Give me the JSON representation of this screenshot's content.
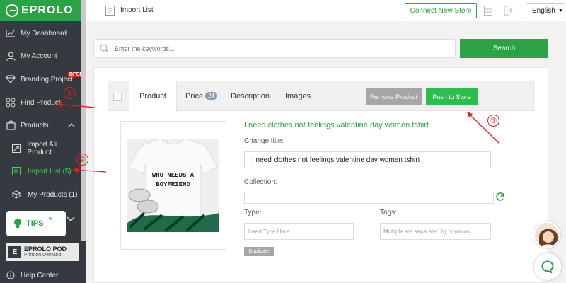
{
  "sidebar": {
    "logo": "EPROLO",
    "items": [
      {
        "label": "My Dashboard"
      },
      {
        "label": "My Account"
      },
      {
        "label": "Branding Project",
        "badge": "BFCM"
      },
      {
        "label": "Find Product"
      },
      {
        "label": "Products"
      },
      {
        "label": "Import Ali Product"
      },
      {
        "label": "Import List (5)"
      },
      {
        "label": "My Products (1)"
      }
    ],
    "tips": "TIPS",
    "pod_line1": "EPROLO POD",
    "pod_line2": "Print on Demand",
    "help": "Help Center"
  },
  "header": {
    "title": "Import List",
    "connect_label": "Connect New Store",
    "language": "English"
  },
  "search": {
    "placeholder": "Enter the keywords...",
    "button": "Search"
  },
  "product": {
    "tabs": [
      {
        "label": "Product"
      },
      {
        "label": "Price",
        "badge": "24"
      },
      {
        "label": "Description"
      },
      {
        "label": "Images"
      }
    ],
    "remove_label": "Remove Product",
    "push_label": "Push to Store",
    "title": "I need clothes not feelings valentine day women tshirt",
    "change_title_label": "Change title:",
    "change_title_value": "I need clothes not feelings  valentine day women tshirt",
    "collection_label": "Collection:",
    "type_label": "Type:",
    "type_placeholder": "Insert Type Here",
    "tags_label": "Tags:",
    "tags_placeholder": "Multiple are separated by commas",
    "duplicate_label": "Duplicate",
    "shirt_text_1": "WHO NEEDS A",
    "shirt_text_2": "BOYFRIEND"
  },
  "annotations": [
    "①",
    "②",
    "③"
  ],
  "colors": {
    "brand_green": "#2ba245",
    "sidebar_bg": "#343a40",
    "annotation_red": "#e02020"
  }
}
